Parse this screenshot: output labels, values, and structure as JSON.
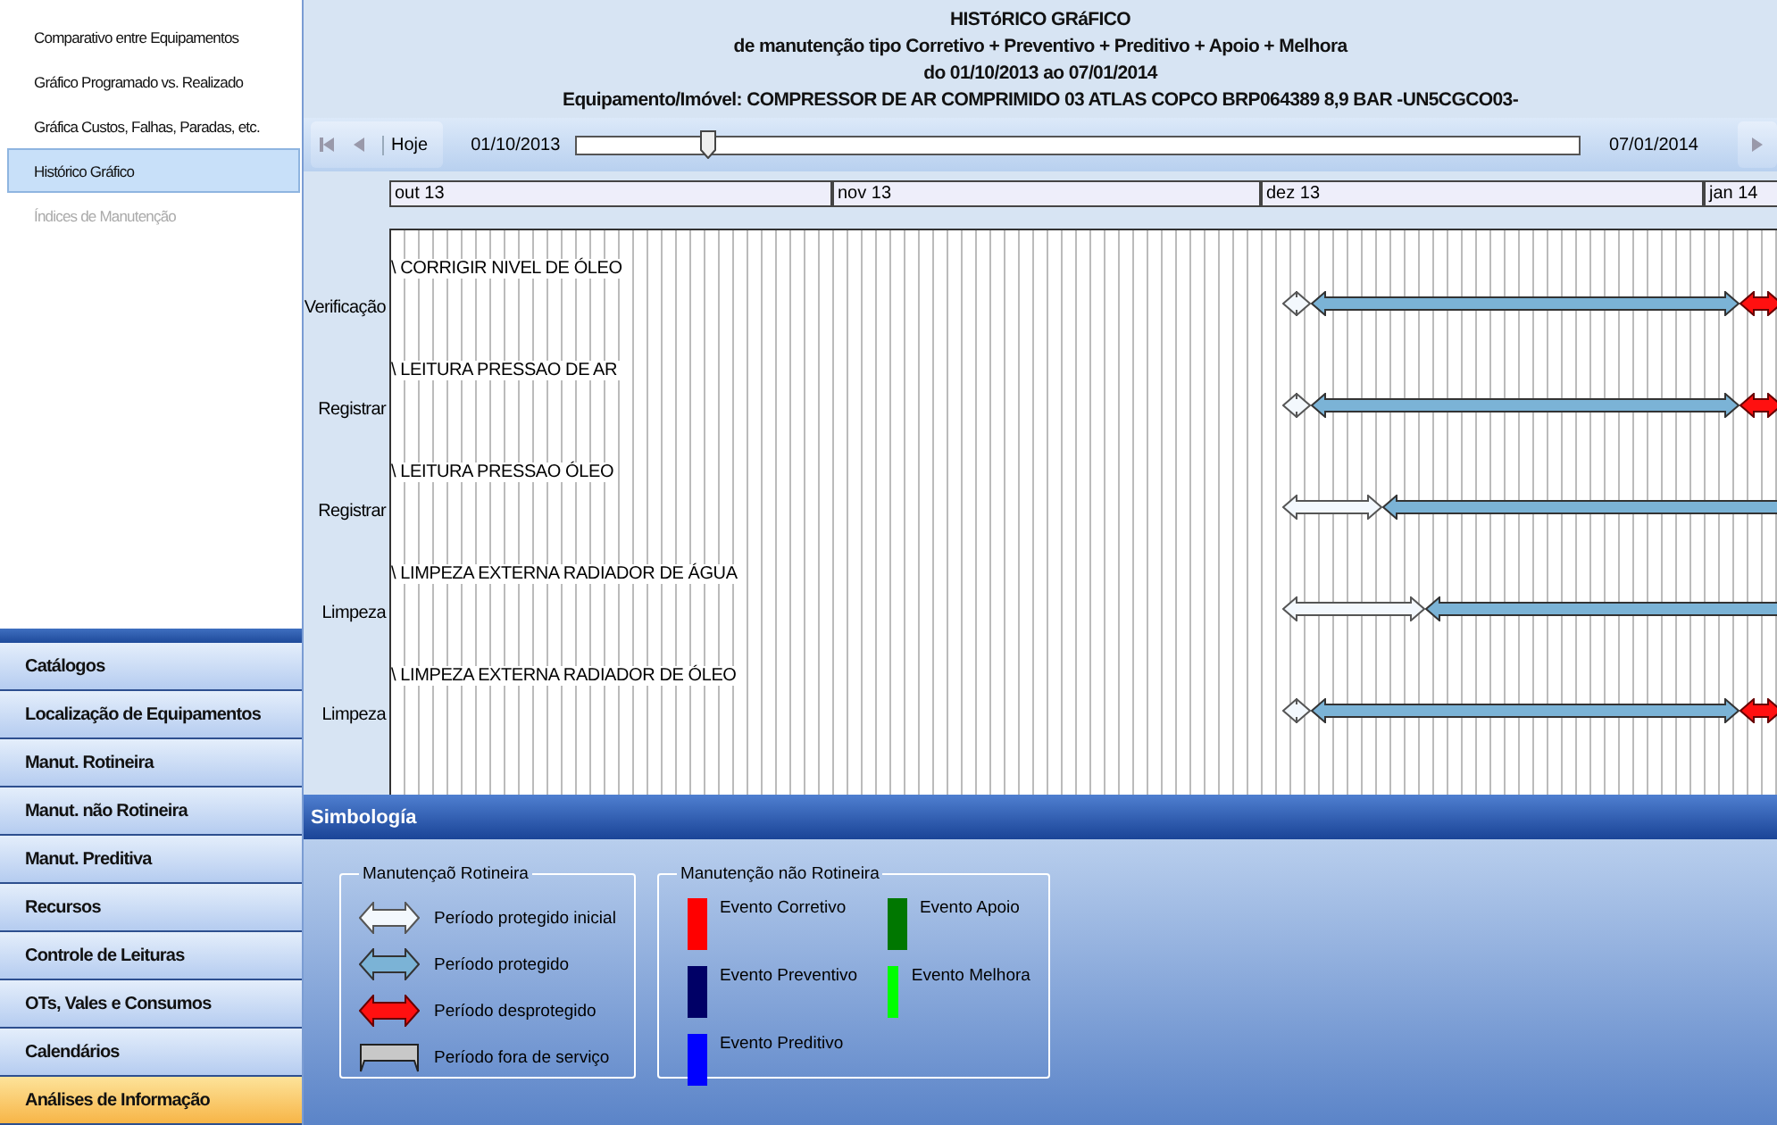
{
  "reports": [
    {
      "label": "Comparativo entre Equipamentos",
      "selected": false,
      "disabled": false
    },
    {
      "label": "Gráfico Programado vs. Realizado",
      "selected": false,
      "disabled": false
    },
    {
      "label": "Gráfica Custos, Falhas, Paradas, etc.",
      "selected": false,
      "disabled": false
    },
    {
      "label": "Histórico Gráfico",
      "selected": true,
      "disabled": false
    },
    {
      "label": "Índices de Manutenção",
      "selected": false,
      "disabled": true
    }
  ],
  "navigation": [
    {
      "label": "Catálogos",
      "selected": false
    },
    {
      "label": "Localização de Equipamentos",
      "selected": false
    },
    {
      "label": "Manut. Rotineira",
      "selected": false
    },
    {
      "label": "Manut. não Rotineira",
      "selected": false
    },
    {
      "label": "Manut. Preditiva",
      "selected": false
    },
    {
      "label": "Recursos",
      "selected": false
    },
    {
      "label": "Controle de Leituras",
      "selected": false
    },
    {
      "label": "OTs, Vales e Consumos",
      "selected": false
    },
    {
      "label": "Calendários",
      "selected": false
    },
    {
      "label": "Análises de Informação",
      "selected": true
    }
  ],
  "header": {
    "title": "HISTóRICO GRáFICO",
    "subtitle": "de manutenção tipo Corretivo + Preventivo + Preditivo + Apoio + Melhora",
    "period": "do 01/10/2013  ao 07/01/2014",
    "equipment": "Equipamento/Imóvel: COMPRESSOR DE AR COMPRIMIDO 03 ATLAS COPCO BRP064389 8,9 BAR -UN5CGCO03-"
  },
  "toolbar": {
    "today_button": "Hoje",
    "start_date": "01/10/2013",
    "end_date": "07/01/2014",
    "slider": {
      "level": 0.13
    }
  },
  "timeline": {
    "months": [
      "out 13",
      "nov 13",
      "dez 13",
      "jan 14"
    ]
  },
  "tasks": [
    {
      "category": "Verificação",
      "name": "\\ CORRIGIR NIVEL DE ÓLEO",
      "periods": [
        {
          "kind": "initial"
        },
        {
          "kind": "protected"
        },
        {
          "kind": "unprotected"
        }
      ]
    },
    {
      "category": "Registrar",
      "name": "\\ LEITURA PRESSAO DE AR",
      "periods": [
        {
          "kind": "initial"
        },
        {
          "kind": "protected"
        },
        {
          "kind": "unprotected"
        }
      ]
    },
    {
      "category": "Registrar",
      "name": "\\ LEITURA PRESSAO ÓLEO",
      "periods": [
        {
          "kind": "initial"
        },
        {
          "kind": "protected"
        }
      ]
    },
    {
      "category": "Limpeza",
      "name": "\\ LIMPEZA EXTERNA RADIADOR DE ÁGUA",
      "periods": [
        {
          "kind": "initial"
        },
        {
          "kind": "protected"
        }
      ]
    },
    {
      "category": "Limpeza",
      "name": "\\ LIMPEZA EXTERNA RADIADOR DE ÓLEO",
      "periods": [
        {
          "kind": "initial"
        },
        {
          "kind": "protected"
        },
        {
          "kind": "unprotected"
        }
      ]
    }
  ],
  "legend": {
    "title": "Simbología",
    "routine": {
      "title": "Manutençaõ Rotineira",
      "items": [
        {
          "kind": "initial",
          "label": "Período protegido inicial"
        },
        {
          "kind": "protected",
          "label": "Período protegido"
        },
        {
          "kind": "unprotected",
          "label": "Período desprotegido"
        },
        {
          "kind": "out_of_service",
          "label": "Período fora de serviço"
        }
      ]
    },
    "non_routine": {
      "title": "Manutenção não Rotineira",
      "items": [
        {
          "label": "Evento Corretivo",
          "color": "#ff0000"
        },
        {
          "label": "Evento Preventivo",
          "color": "#000066"
        },
        {
          "label": "Evento Preditivo",
          "color": "#0000ff"
        },
        {
          "label": "Evento Apoio",
          "color": "#007700"
        },
        {
          "label": "Evento Melhora",
          "color": "#00ff00"
        }
      ]
    }
  }
}
